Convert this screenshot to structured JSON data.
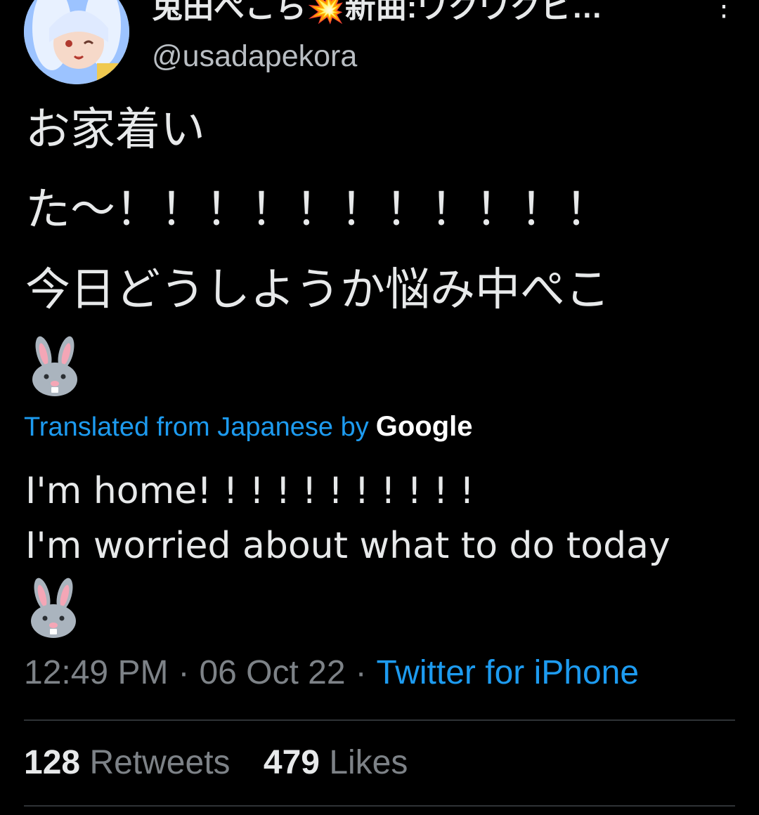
{
  "author": {
    "display_name": "兎田ぺこら💥新曲:ワクワクピ…",
    "handle": "@usadapekora",
    "avatar_icon": "avatar-image"
  },
  "tweet": {
    "japanese_lines": [
      "お家着い",
      "た〜！！！！！！！！！！！",
      "今日どうしようか悩み中ぺこ"
    ],
    "japanese_emoji": "rabbit-face-emoji",
    "translation_label": "Translated from Japanese by",
    "translation_provider": "Google",
    "english_lines": [
      "I'm home! ! ! ! ! ! ! ! ! ! !",
      "I'm worried about what to do today"
    ],
    "english_emoji": "rabbit-face-emoji"
  },
  "meta": {
    "time": "12:49 PM",
    "date": "06 Oct 22",
    "separator": "·",
    "source": "Twitter for iPhone"
  },
  "stats": {
    "retweets_count": "128",
    "retweets_label": "Retweets",
    "likes_count": "479",
    "likes_label": "Likes"
  },
  "colors": {
    "background": "#000000",
    "text": "#e7e9ea",
    "muted": "#7d8287",
    "link": "#1d9bf0",
    "divider": "#2f3336"
  }
}
